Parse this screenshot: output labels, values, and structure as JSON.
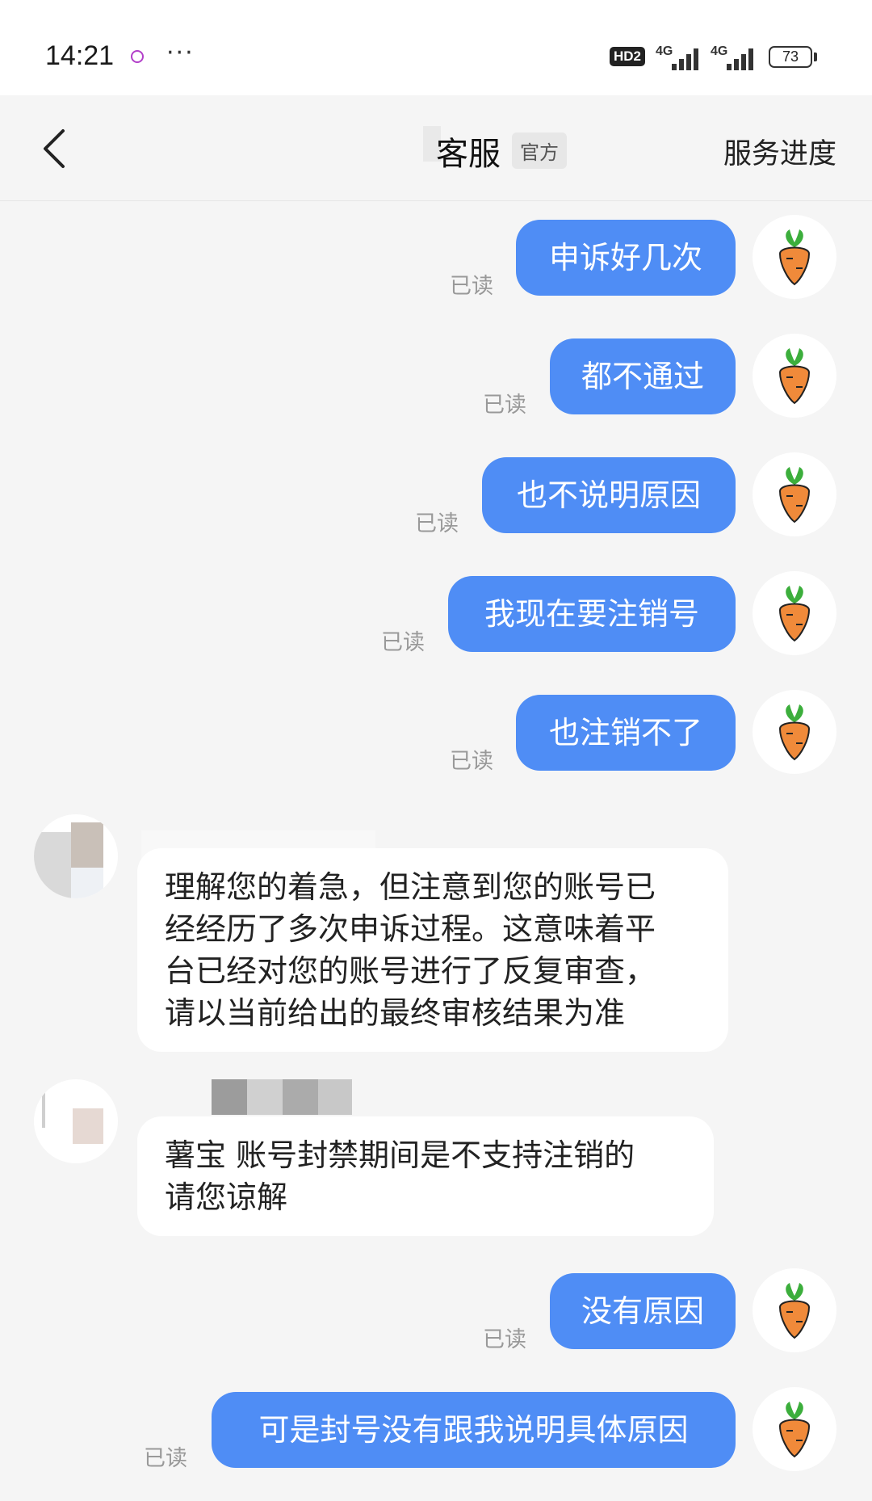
{
  "status_bar": {
    "time": "14:21",
    "dots": "···",
    "hd_label": "HD2",
    "network1": "4G",
    "network2": "4G",
    "battery": "73"
  },
  "header": {
    "back_icon": "chevron-left-icon",
    "title": "客服",
    "badge": "官方",
    "progress_link": "服务进度"
  },
  "messages": [
    {
      "side": "out",
      "text": "申诉好几次",
      "read": "已读"
    },
    {
      "side": "out",
      "text": "都不通过",
      "read": "已读"
    },
    {
      "side": "out",
      "text": "也不说明原因",
      "read": "已读"
    },
    {
      "side": "out",
      "text": "我现在要注销号",
      "read": "已读"
    },
    {
      "side": "out",
      "text": "也注销不了",
      "read": "已读"
    },
    {
      "side": "in",
      "text": "理解您的着急，但注意到您的账号已\n经经历了多次申诉过程。这意味着平\n台已经对您的账号进行了反复审查，\n请以当前给出的最终审核结果为准"
    },
    {
      "side": "in",
      "text": "薯宝 账号封禁期间是不支持注销的\n请您谅解"
    },
    {
      "side": "out",
      "text": "没有原因",
      "read": "已读"
    },
    {
      "side": "out",
      "text": "可是封号没有跟我说明具体原因",
      "read": "已读"
    }
  ],
  "colors": {
    "outgoing_bubble": "#4f8df5",
    "incoming_bubble": "#ffffff",
    "background": "#f5f5f5",
    "read_text": "#999999"
  },
  "avatar_icon": "carrot-icon"
}
